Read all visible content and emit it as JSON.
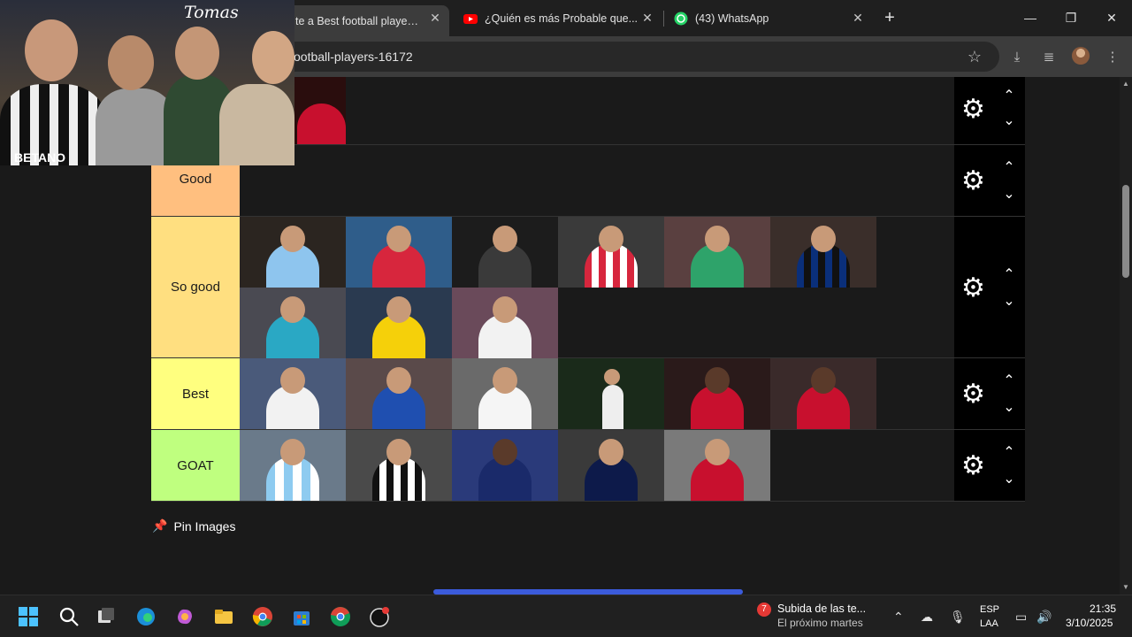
{
  "browser": {
    "tabs": [
      {
        "title": "te a Best football players T",
        "active": true
      },
      {
        "title": "¿Quién es más Probable que...",
        "active": false
      },
      {
        "title": "(43) WhatsApp",
        "active": false
      }
    ],
    "close_symbol": "✕",
    "new_tab_symbol": "+",
    "url": "ootball-players-16172",
    "window_controls": {
      "minimize": "—",
      "maximize": "❐",
      "close": "✕"
    },
    "toolbar_icons": {
      "star": "☆",
      "download": "⤓",
      "media": "≣",
      "menu": "⋮"
    }
  },
  "webcam": {
    "name": "Tomas",
    "shirt_brand": "BETANO"
  },
  "tiers": [
    {
      "label": "",
      "color": "#1a1a1a",
      "images": 1
    },
    {
      "label": "Good",
      "color": "#ffbf7f",
      "images": 0
    },
    {
      "label": "So good",
      "color": "#ffdf80",
      "images": 9
    },
    {
      "label": "Best",
      "color": "#ffff7f",
      "images": 6
    },
    {
      "label": "GOAT",
      "color": "#bfff7f",
      "images": 5
    }
  ],
  "controls": {
    "gear": "⚙",
    "up": "⌃",
    "down": "⌄"
  },
  "pin_images": {
    "label": "Pin Images",
    "icon": "pushpin-icon"
  },
  "taskbar": {
    "notification_title": "Subida de las te...",
    "notification_sub": "El próximo martes",
    "notification_badge": "7",
    "lang_top": "ESP",
    "lang_bottom": "LAA",
    "time": "21:35",
    "date": "3/10/2025"
  }
}
